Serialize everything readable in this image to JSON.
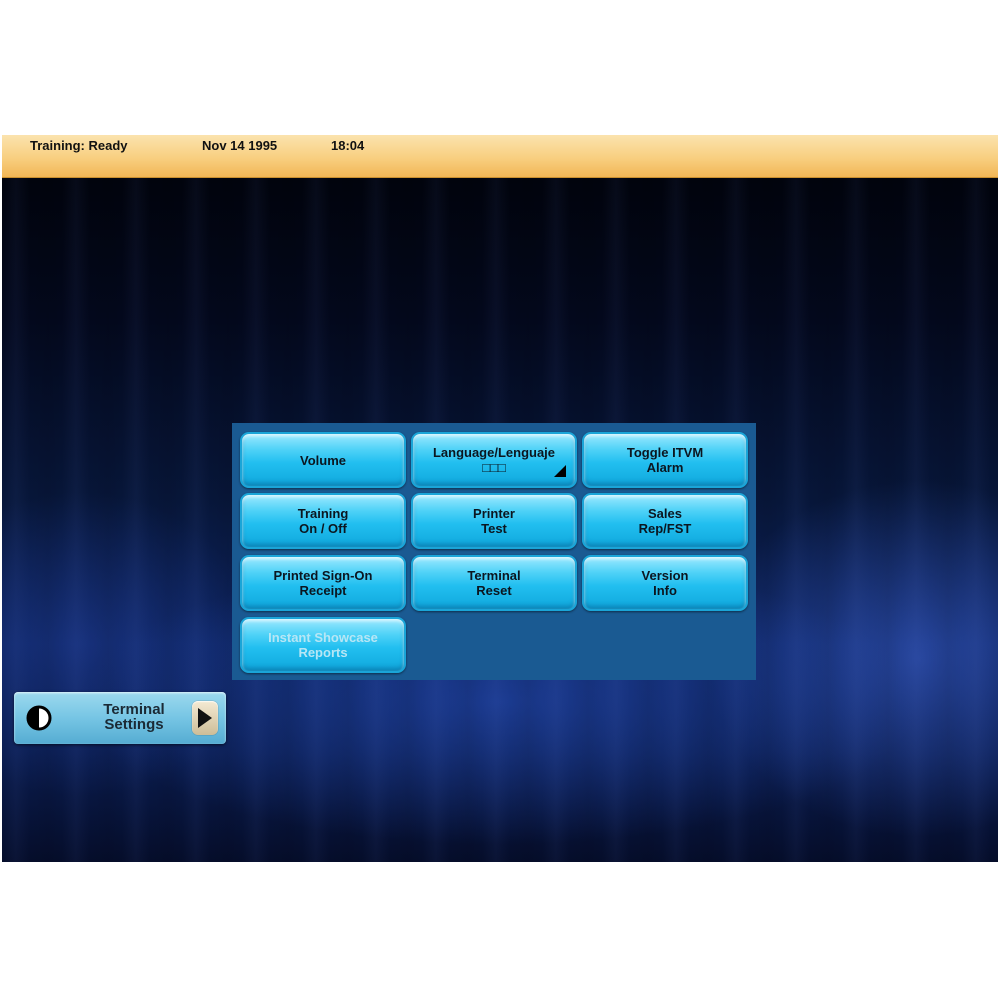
{
  "status_bar": {
    "mode": "Training: Ready",
    "date": "Nov 14 1995",
    "time": "18:04"
  },
  "menu": {
    "buttons": [
      {
        "line1": "Volume",
        "line2": ""
      },
      {
        "line1": "Language/Lenguaje",
        "line2": "□□□"
      },
      {
        "line1": "Toggle ITVM",
        "line2": "Alarm"
      },
      {
        "line1": "Training",
        "line2": "On / Off"
      },
      {
        "line1": "Printer",
        "line2": "Test"
      },
      {
        "line1": "Sales",
        "line2": "Rep/FST"
      },
      {
        "line1": "Printed Sign-On",
        "line2": "Receipt"
      },
      {
        "line1": "Terminal",
        "line2": "Reset"
      },
      {
        "line1": "Version",
        "line2": "Info"
      },
      {
        "line1": "Instant Showcase",
        "line2": "Reports"
      }
    ]
  },
  "terminal_settings": {
    "line1": "Terminal",
    "line2": "Settings",
    "icon": "contrast-icon"
  },
  "colors": {
    "status_bar": "#f8cf80",
    "panel": "#1a5a92",
    "button": "#22bff0",
    "disabled_text": "#b7e6f5"
  }
}
